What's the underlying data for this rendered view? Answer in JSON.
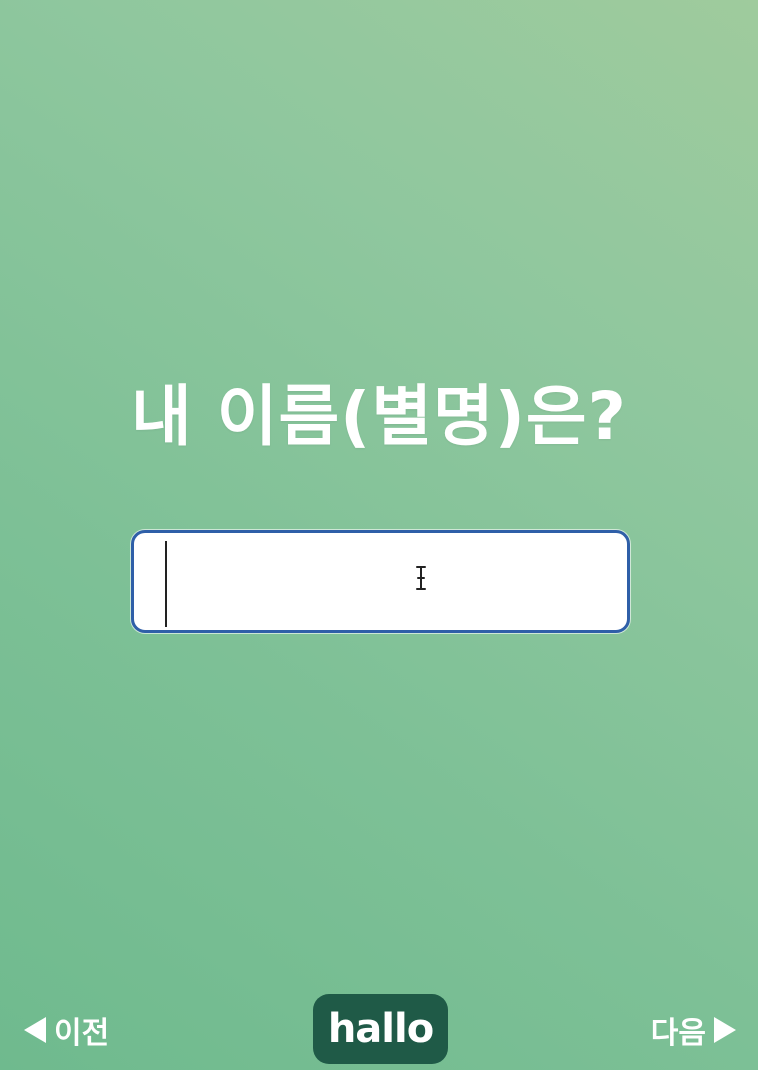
{
  "question": {
    "text": "내 이름(별명)은?"
  },
  "name_input": {
    "value": "",
    "placeholder": ""
  },
  "nav": {
    "prev_label": "이전",
    "next_label": "다음"
  },
  "logo": {
    "text": "hallo"
  },
  "colors": {
    "background_start": "#9fcb9d",
    "background_end": "#6fba8e",
    "input_border": "#2f5fa8",
    "logo_background": "#1f5a47",
    "text": "#ffffff"
  },
  "icons": {
    "prev": "triangle-left-icon",
    "next": "triangle-right-icon",
    "cursor": "text-cursor-icon"
  }
}
